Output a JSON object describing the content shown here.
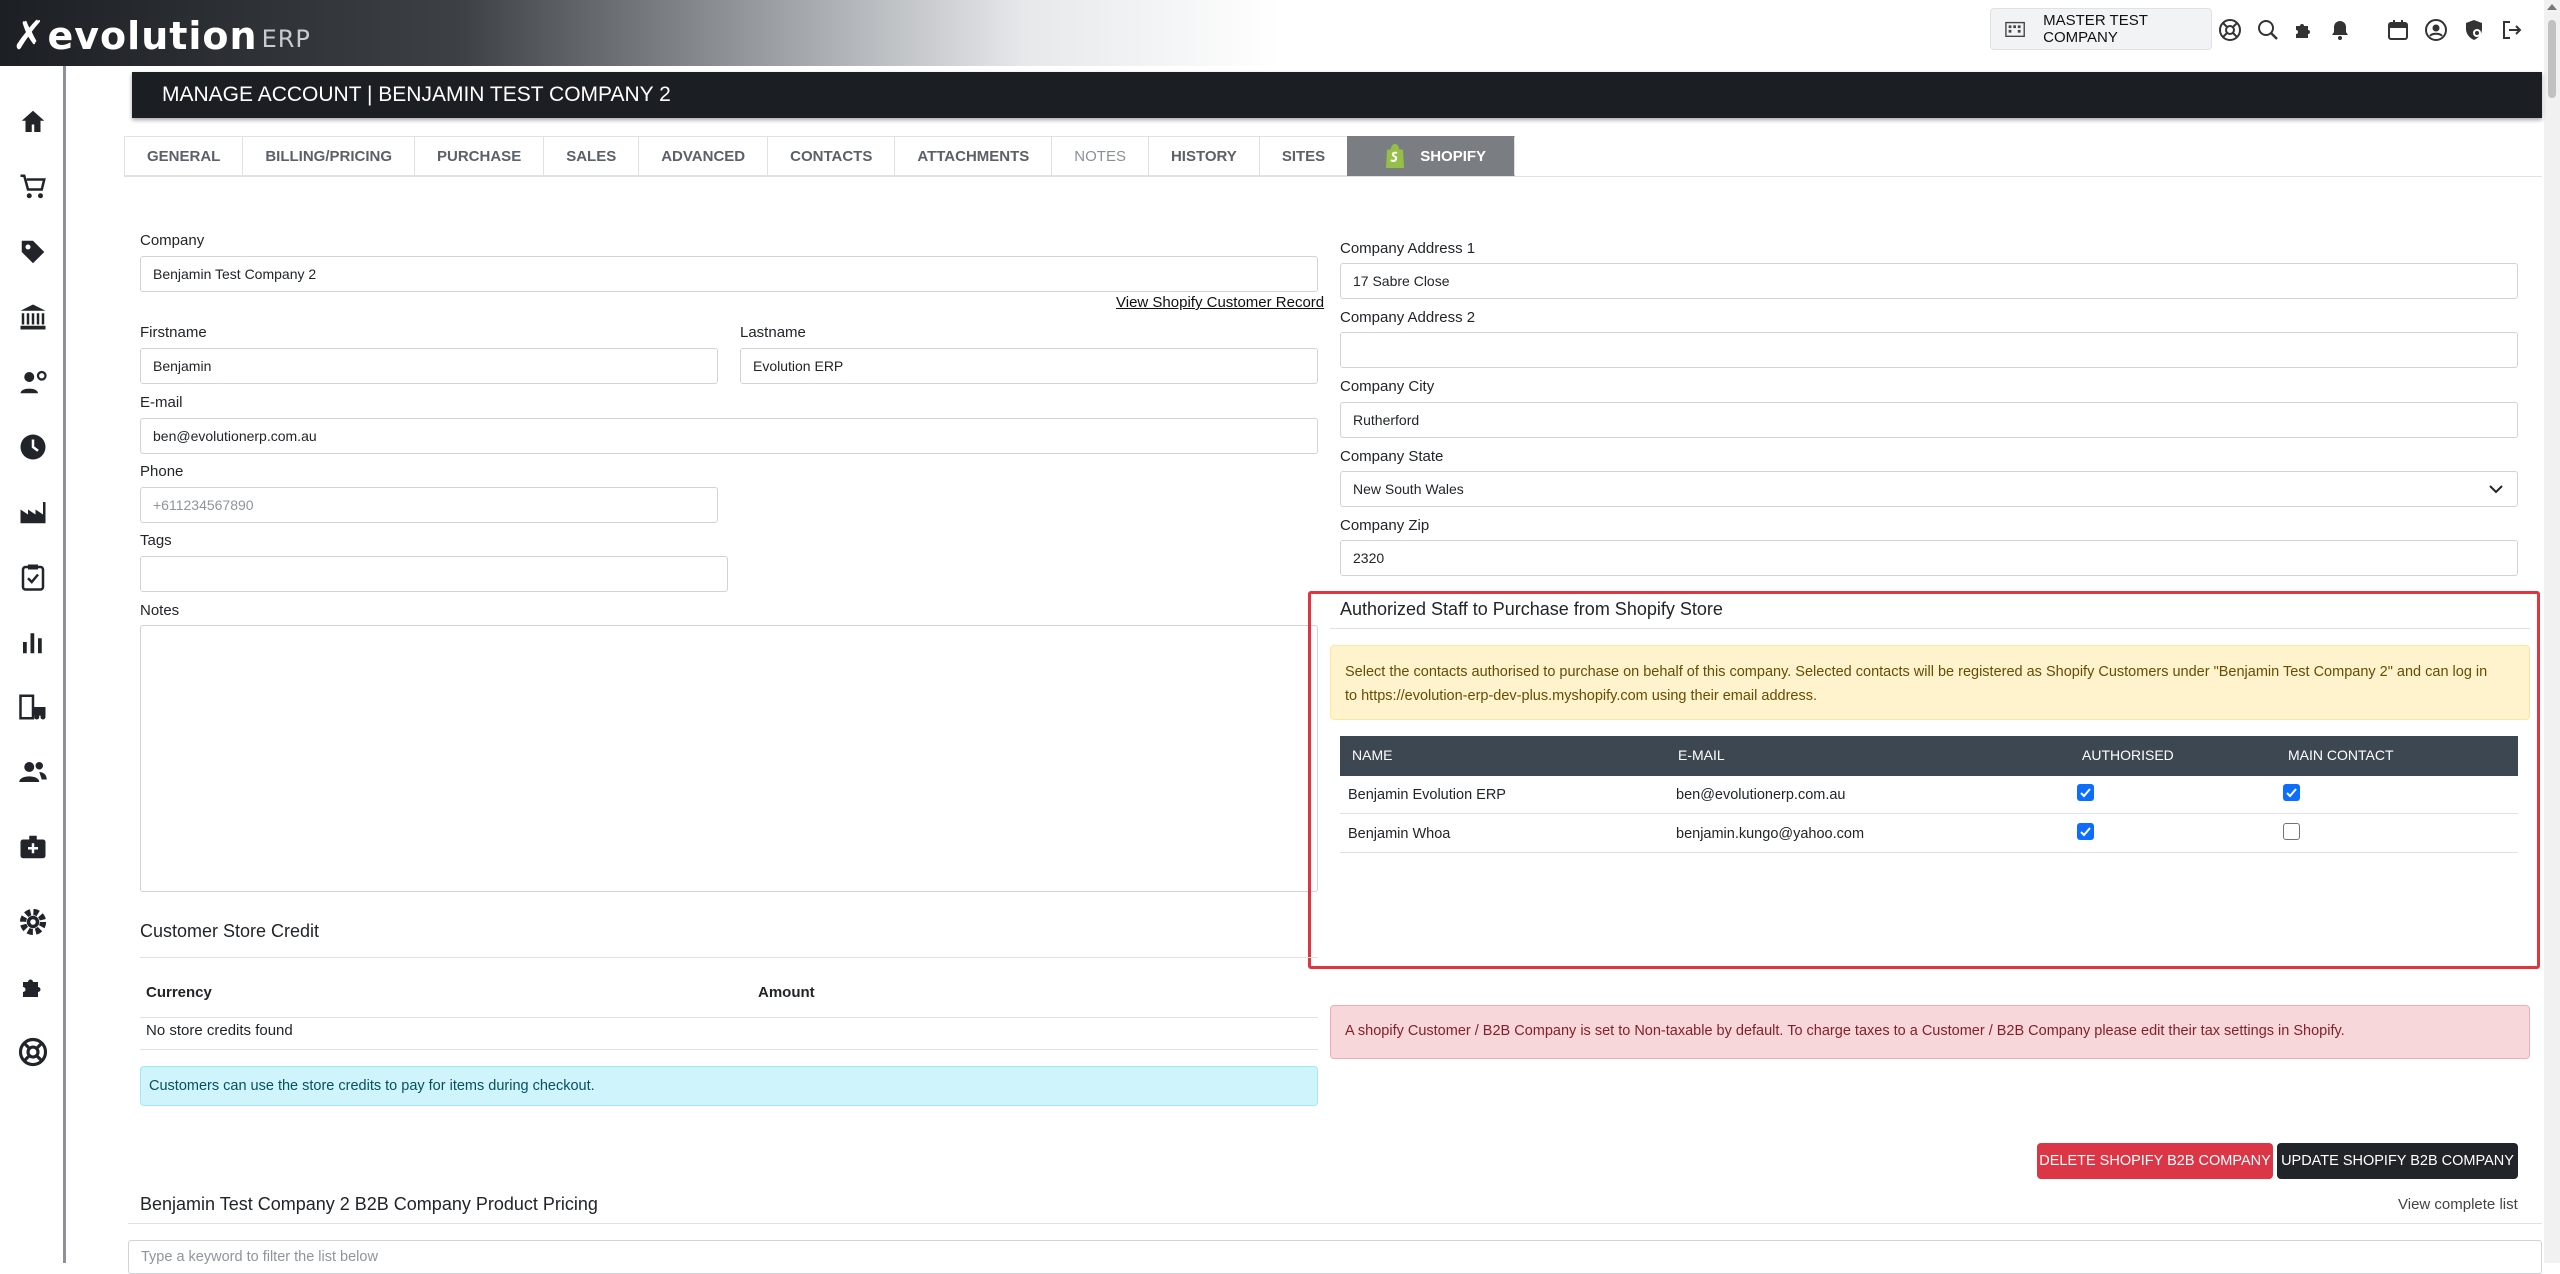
{
  "app": {
    "logo_main": "evolution",
    "logo_suffix": "ERP",
    "company_selector": "MASTER TEST COMPANY"
  },
  "page": {
    "title": "MANAGE ACCOUNT | BENJAMIN TEST COMPANY 2"
  },
  "tabs": [
    {
      "label": "GENERAL"
    },
    {
      "label": "BILLING/PRICING"
    },
    {
      "label": "PURCHASE"
    },
    {
      "label": "SALES"
    },
    {
      "label": "ADVANCED"
    },
    {
      "label": "CONTACTS"
    },
    {
      "label": "ATTACHMENTS"
    },
    {
      "label": "NOTES"
    },
    {
      "label": "HISTORY"
    },
    {
      "label": "SITES"
    },
    {
      "label": "SHOPIFY"
    }
  ],
  "form": {
    "company_label": "Company",
    "company_value": "Benjamin Test Company 2",
    "view_record_link": "View Shopify Customer Record",
    "firstname_label": "Firstname",
    "firstname_value": "Benjamin",
    "lastname_label": "Lastname",
    "lastname_value": "Evolution ERP",
    "email_label": "E-mail",
    "email_value": "ben@evolutionerp.com.au",
    "phone_label": "Phone",
    "phone_placeholder": "+611234567890",
    "tags_label": "Tags",
    "tags_value": "",
    "notes_label": "Notes",
    "address1_label": "Company Address 1",
    "address1_value": "17 Sabre Close",
    "address2_label": "Company Address 2",
    "address2_value": "",
    "city_label": "Company City",
    "city_value": "Rutherford",
    "state_label": "Company State",
    "state_value": "New South Wales",
    "zip_label": "Company Zip",
    "zip_value": "2320"
  },
  "authorized": {
    "title": "Authorized Staff to Purchase from Shopify Store",
    "notice_line1": "Select the contacts authorised to purchase on behalf of this company. Selected contacts will be registered as Shopify Customers under \"Benjamin Test Company 2\" and can log in",
    "notice_line2": "to https://evolution-erp-dev-plus.myshopify.com using their email address.",
    "headers": {
      "name": "NAME",
      "email": "E-MAIL",
      "authorised": "AUTHORISED",
      "main": "MAIN CONTACT"
    },
    "rows": [
      {
        "name": "Benjamin Evolution ERP",
        "email": "ben@evolutionerp.com.au",
        "authorised": true,
        "main": true
      },
      {
        "name": "Benjamin Whoa",
        "email": "benjamin.kungo@yahoo.com",
        "authorised": true,
        "main": false
      }
    ]
  },
  "tax_notice": "A shopify Customer / B2B Company is set to Non-taxable by default.  To charge taxes to a Customer / B2B Company please edit their tax settings in Shopify.",
  "store_credit": {
    "title": "Customer Store Credit",
    "col_currency": "Currency",
    "col_amount": "Amount",
    "empty": "No store credits found",
    "info": "Customers can use the store credits to pay for items during checkout."
  },
  "actions": {
    "delete_label": "DELETE SHOPIFY B2B COMPANY",
    "update_label": "UPDATE SHOPIFY B2B COMPANY"
  },
  "pricing": {
    "title": "Benjamin Test Company 2 B2B Company Product Pricing",
    "view_list": "View complete list",
    "filter_placeholder": "Type a keyword to filter the list below"
  },
  "colors": {
    "accent_blue": "#0d6efd",
    "danger": "#dc3545",
    "dark": "#212529",
    "highlight_box": "#e0343f",
    "shopify_green": "#95bf47"
  }
}
